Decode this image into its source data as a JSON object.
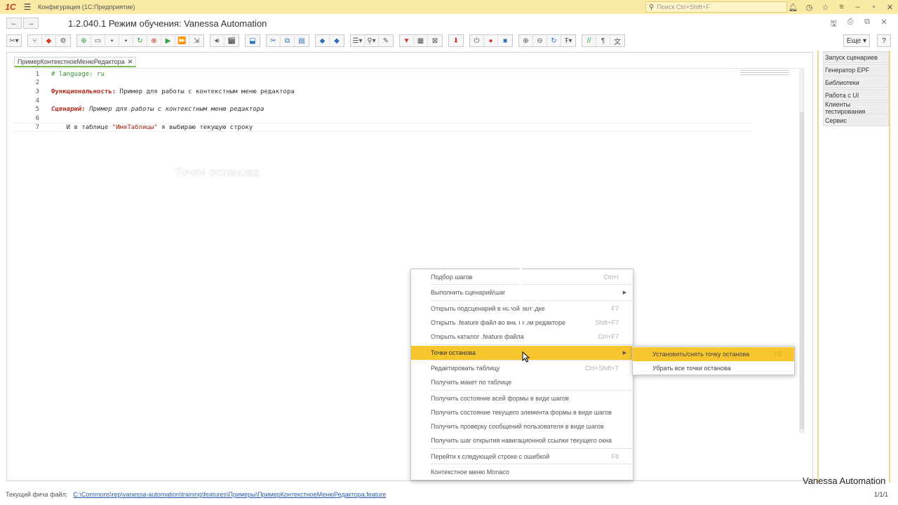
{
  "titlebar": {
    "logo": "1С",
    "app_title": "Конфигурация  (1С:Предприятие)",
    "search_placeholder": "Поиск Ctrl+Shift+F"
  },
  "page": {
    "title": "1.2.040.1 Режим обучения: Vanessa Automation",
    "more_label": "Еще",
    "help_label": "?"
  },
  "editor": {
    "tab_label": "ПримерКонтекстноеМенюРедактора",
    "lines": [
      {
        "n": "1",
        "kind": "comment",
        "text": "# language: ru"
      },
      {
        "n": "2",
        "kind": "plain",
        "text": ""
      },
      {
        "n": "3",
        "kind": "feature",
        "kw": "Функциональность:",
        "text": " Пример для работы с контекстным меню редактора"
      },
      {
        "n": "4",
        "kind": "plain",
        "text": ""
      },
      {
        "n": "5",
        "kind": "scenario",
        "kw": "Сценарий:",
        "text": " Пример для работы с контекстным меню редактора"
      },
      {
        "n": "6",
        "kind": "plain",
        "text": ""
      },
      {
        "n": "7",
        "kind": "step",
        "pre": "    И в таблице ",
        "str": "\"ИмяТаблицы\"",
        "post": " я выбираю текущую строку"
      }
    ]
  },
  "right_panel": {
    "items": [
      "Запуск сценариев",
      "Генератор EPF",
      "Библиотеки",
      "Работа с UI",
      "Клиенты тестирования",
      "Сервис"
    ]
  },
  "context_menu": {
    "items": [
      {
        "label": "Подбор шагов",
        "shortcut": "Ctrl+I"
      },
      {
        "label": "Выполнить сценарий/шаг",
        "submenu": true
      },
      {
        "label": "Открыть подсценарий в новой вкладке",
        "shortcut": "F7"
      },
      {
        "label": "Открыть .feature файл во внешнем редакторе",
        "shortcut": "Shift+F7"
      },
      {
        "label": "Открыть каталог .feature файла",
        "shortcut": "Ctrl+F7"
      },
      {
        "label": "Точки останова",
        "submenu": true,
        "highlighted": true
      },
      {
        "label": "Редактировать таблицу",
        "shortcut": "Ctrl+Shift+T"
      },
      {
        "label": "Получить макет по таблице",
        "shortcut": ""
      },
      {
        "label": "Получить состояние всей формы в виде шагов",
        "shortcut": ""
      },
      {
        "label": "Получить состояние текущего элемента формы в виде шагов",
        "shortcut": ""
      },
      {
        "label": "Получить проверку сообщений пользователя в виде шагов",
        "shortcut": ""
      },
      {
        "label": "Получить шаг открытия навигационной ссылки текущего окна",
        "shortcut": ""
      },
      {
        "label": "Перейти к следующей строке с ошибкой",
        "shortcut": "F8"
      },
      {
        "label": "Контекстное меню Monaco",
        "shortcut": ""
      }
    ]
  },
  "submenu": {
    "items": [
      {
        "label": "Установить/снять точку останова",
        "shortcut": "F9",
        "highlighted": true
      },
      {
        "label": "Убрать все точки останова",
        "shortcut": ""
      }
    ]
  },
  "annotation": {
    "text": "Точки останова"
  },
  "statusbar": {
    "label": "Текущий фича файл:",
    "path": "C:\\Commons\\rep\\vanessa-automation\\training\\features\\Примеры\\ПримерКонтекстноеМенюРедактора.feature",
    "count": "1/1/1"
  },
  "watermark": "Vanessa Automation",
  "colors": {
    "titlebar": "#fbe9a6",
    "highlight": "#f7c62f",
    "tab_underline": "#7ebc4a",
    "keyword_red": "#b5281f",
    "comment_green": "#2f8f2f"
  }
}
